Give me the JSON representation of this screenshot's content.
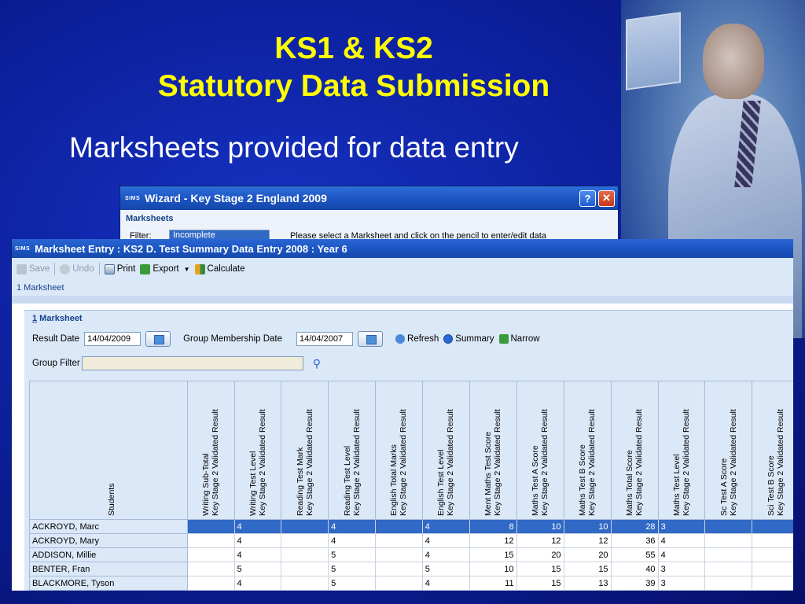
{
  "slide": {
    "title_line1": "KS1 & KS2",
    "title_line2": "Statutory Data Submission",
    "subtitle": "Marksheets provided for data entry"
  },
  "wizard": {
    "title": "Wizard - Key Stage 2 England 2009",
    "logo": "SIMS",
    "help": "?",
    "close": "✕",
    "section": "Marksheets",
    "filter_label": "Filter:",
    "filter_value": "Incomplete",
    "instruction": "Please select a Marksheet and click on the pencil to enter/edit data"
  },
  "marksheet": {
    "title": "Marksheet Entry : KS2 D. Test Summary Data Entry 2008 : Year  6",
    "logo": "SIMS",
    "toolbar": {
      "save": "Save",
      "undo": "Undo",
      "print": "Print",
      "export": "Export",
      "calculate": "Calculate"
    },
    "breadcrumb": "1 Marksheet",
    "panel": {
      "title_num": "1",
      "title_text": " Marksheet",
      "result_date_label": "Result Date",
      "result_date": "14/04/2009",
      "group_membership_label": "Group Membership Date",
      "group_membership_date": "14/04/2007",
      "refresh": "Refresh",
      "summary": "Summary",
      "narrow": "Narrow",
      "group_filter_label": "Group Filter"
    },
    "columns": [
      {
        "line1": "Writing Sub-Total",
        "line2": "Key Stage 2 Validated Result"
      },
      {
        "line1": "Writing Test Level",
        "line2": "Key Stage 2 Validated Result"
      },
      {
        "line1": "Reading Test Mark",
        "line2": "Key Stage 2 Validated Result"
      },
      {
        "line1": "Reading Test Level",
        "line2": "Key Stage 2 Validated Result"
      },
      {
        "line1": "English Total Marks",
        "line2": "Key Stage 2 Validated Result"
      },
      {
        "line1": "English Test Level",
        "line2": "Key Stage 2 Validated Result"
      },
      {
        "line1": "Ment Maths Test Score",
        "line2": "Key Stage 2 Validated Result"
      },
      {
        "line1": "Maths Test A Score",
        "line2": "Key Stage 2 Validated Result"
      },
      {
        "line1": "Maths Test B Score",
        "line2": "Key Stage 2 Validated Result"
      },
      {
        "line1": "Maths Total Score",
        "line2": "Key Stage 2 Validated Result"
      },
      {
        "line1": "Maths Test Level",
        "line2": "Key Stage 2 Validated Result"
      },
      {
        "line1": "Sc Test A Score",
        "line2": "Key Stage 2 Validated Result"
      },
      {
        "line1": "Sci Test B Score",
        "line2": "Key Stage 2 Validated Result"
      }
    ],
    "students_header": "Students",
    "rows": [
      {
        "name": "ACKROYD, Marc",
        "cells": [
          "",
          "4",
          "",
          "4",
          "",
          "4",
          "8",
          "10",
          "10",
          "28",
          "3",
          "",
          ""
        ]
      },
      {
        "name": "ACKROYD, Mary",
        "cells": [
          "",
          "4",
          "",
          "4",
          "",
          "4",
          "12",
          "12",
          "12",
          "36",
          "4",
          "",
          ""
        ]
      },
      {
        "name": "ADDISON, Millie",
        "cells": [
          "",
          "4",
          "",
          "5",
          "",
          "4",
          "15",
          "20",
          "20",
          "55",
          "4",
          "",
          ""
        ]
      },
      {
        "name": "BENTER, Fran",
        "cells": [
          "",
          "5",
          "",
          "5",
          "",
          "5",
          "10",
          "15",
          "15",
          "40",
          "3",
          "",
          ""
        ]
      },
      {
        "name": "BLACKMORE, Tyson",
        "cells": [
          "",
          "4",
          "",
          "5",
          "",
          "4",
          "11",
          "15",
          "13",
          "39",
          "3",
          "",
          ""
        ]
      }
    ]
  }
}
